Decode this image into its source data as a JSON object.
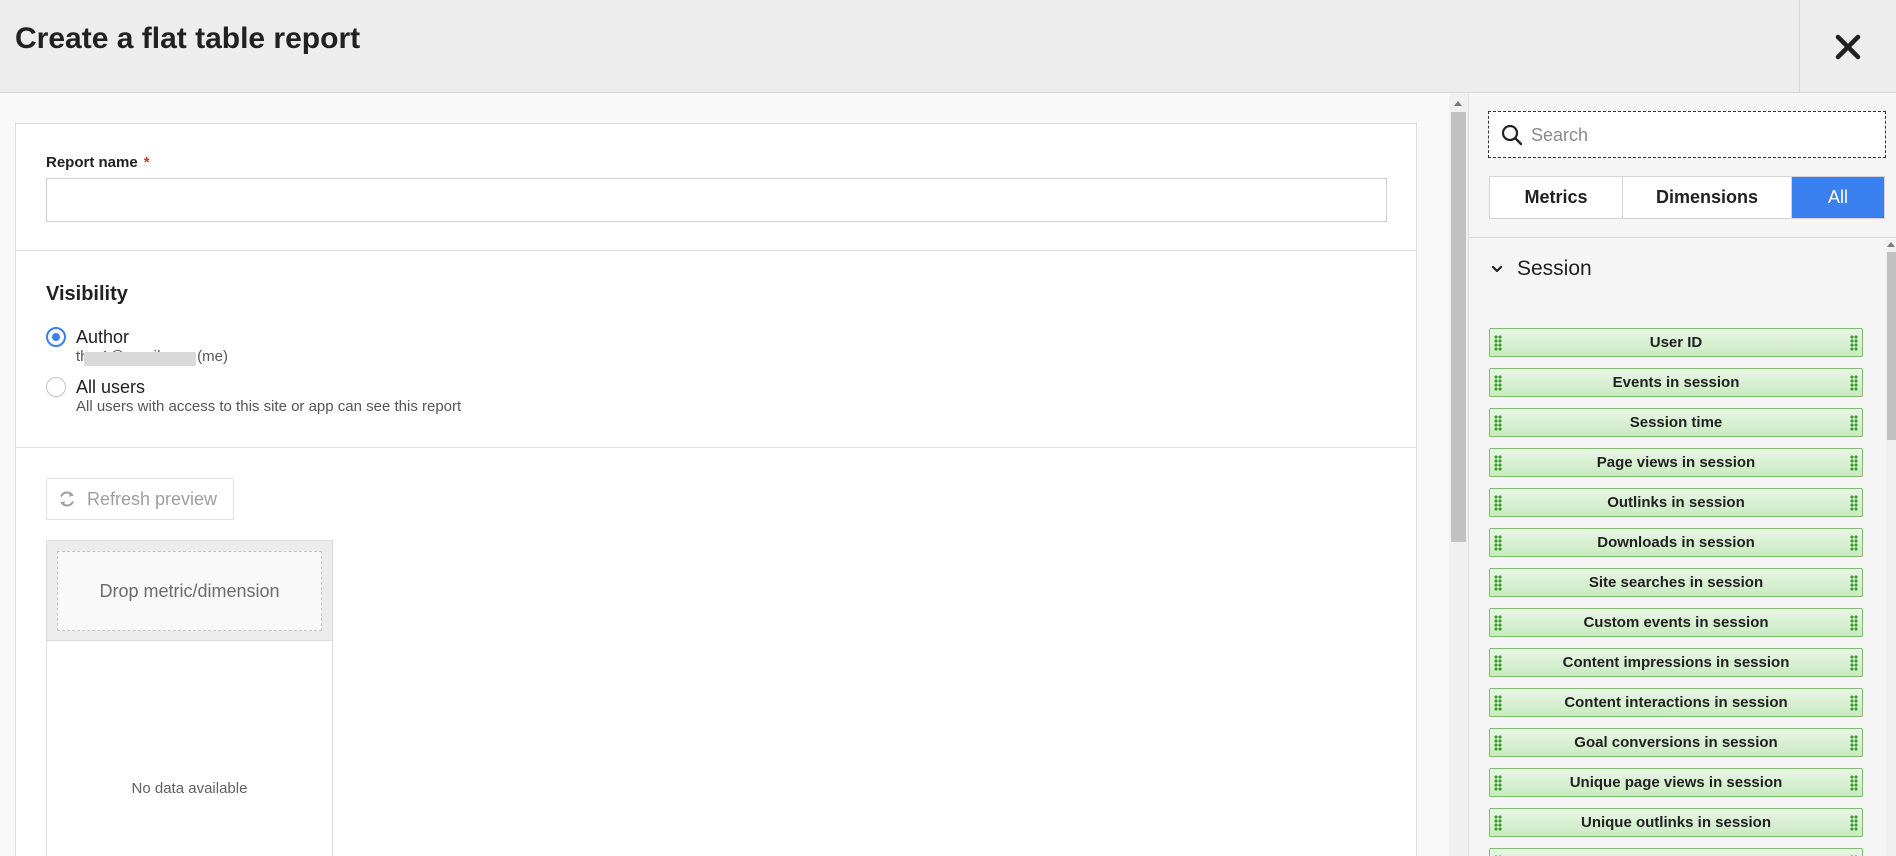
{
  "header": {
    "title": "Create a flat table report"
  },
  "form": {
    "report_name_label": "Report name",
    "required_mark": "*",
    "report_name_value": ""
  },
  "visibility": {
    "title": "Visibility",
    "options": [
      {
        "label": "Author",
        "sub": "the          1@gmail.com (me)",
        "checked": true
      },
      {
        "label": "All users",
        "sub": "All users with access to this site or app can see this report",
        "checked": false
      }
    ]
  },
  "preview": {
    "refresh_label": "Refresh preview",
    "drop_label": "Drop metric/dimension",
    "no_data": "No data available"
  },
  "panel": {
    "search_placeholder": "Search",
    "tabs": [
      "Metrics",
      "Dimensions",
      "All"
    ],
    "active_tab": "All",
    "group": "Session",
    "fields": [
      "User ID",
      "Events in session",
      "Session time",
      "Page views in session",
      "Outlinks in session",
      "Downloads in session",
      "Site searches in session",
      "Custom events in session",
      "Content impressions in session",
      "Content interactions in session",
      "Goal conversions in session",
      "Unique page views in session",
      "Unique outlinks in session"
    ]
  },
  "colors": {
    "accent": "#3b80ef",
    "field_border": "#7dbf6e",
    "required": "#d32f2f"
  },
  "icons": [
    "close-icon",
    "refresh-icon",
    "search-icon",
    "chevron-down-icon",
    "drag-handle-icon"
  ]
}
